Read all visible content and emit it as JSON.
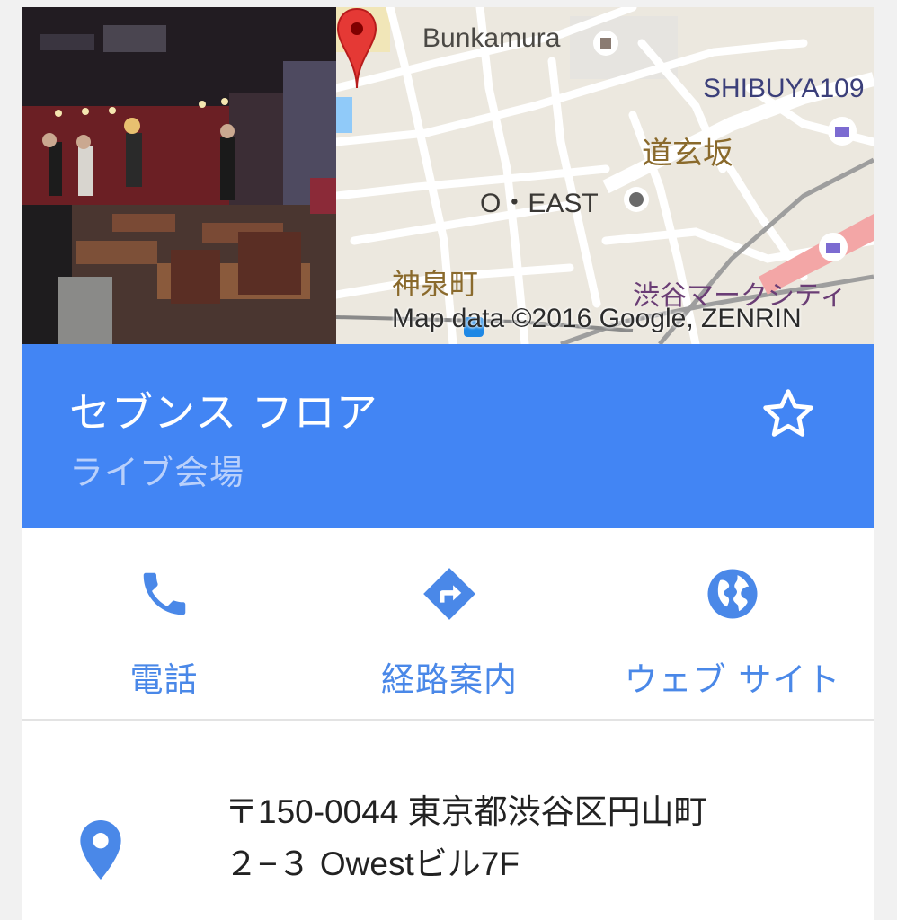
{
  "map": {
    "labels": {
      "bunkamura": "Bunkamura",
      "shibuya109": "SHIBUYA109",
      "dogenzaka": "道玄坂",
      "oeast": "O・EAST",
      "shinsencho": "神泉町",
      "marksity": "渋谷マークシティ",
      "attribution": "Map data ©2016 Google, ZENRIN"
    }
  },
  "place": {
    "name": "セブンス フロア",
    "category": "ライブ会場"
  },
  "actions": {
    "call": "電話",
    "directions": "経路案内",
    "website": "ウェブ サイト"
  },
  "address": {
    "line1": "〒150-0044 東京都渋谷区円山町",
    "line2": "２−３ Owestビル7F"
  },
  "colors": {
    "header": "#4285f4",
    "accent": "#4a88e8",
    "pin": "#e53935"
  },
  "icons": {
    "star": "star-outline-icon",
    "call": "phone-icon",
    "directions": "directions-icon",
    "website": "globe-icon",
    "address": "location-pin-icon"
  }
}
